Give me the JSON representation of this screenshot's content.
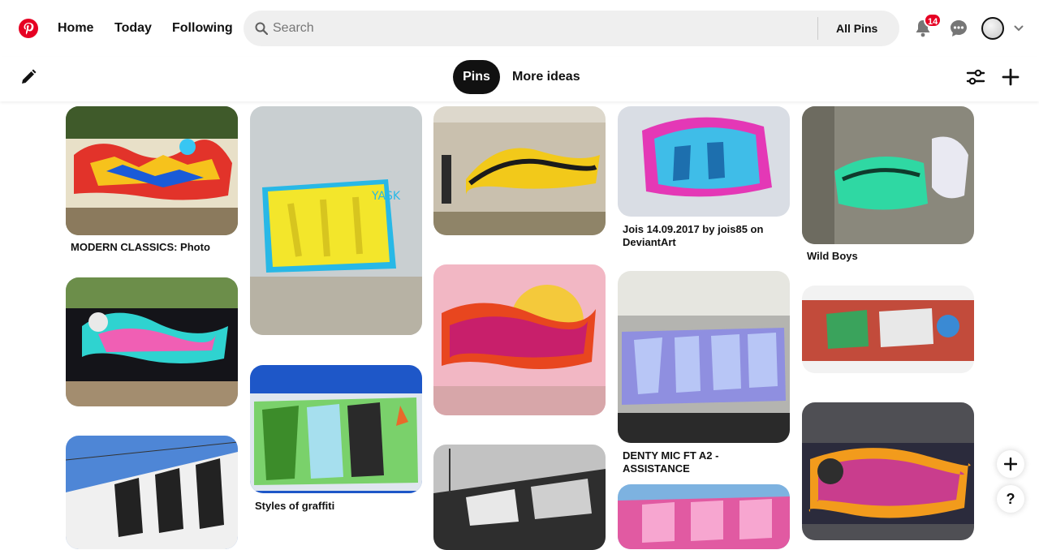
{
  "nav": {
    "home": "Home",
    "today": "Today",
    "following": "Following",
    "search_placeholder": "Search",
    "filter": "All Pins",
    "notifications_count": "14"
  },
  "subbar": {
    "pins_tab": "Pins",
    "more_ideas_tab": "More ideas"
  },
  "pins": [
    {
      "title": "MODERN CLASSICS: Photo"
    },
    {
      "title": ""
    },
    {
      "title": ""
    },
    {
      "title": "Jois 14.09.2017 by jois85 on DeviantArt"
    },
    {
      "title": "Wild Boys"
    },
    {
      "title": ""
    },
    {
      "title": "Styles of graffiti"
    },
    {
      "title": ""
    },
    {
      "title": "DENTY MIC FT A2 -ASSISTANCE"
    },
    {
      "title": ""
    },
    {
      "title": ""
    },
    {
      "title": ""
    },
    {
      "title": ""
    },
    {
      "title": ""
    }
  ],
  "help": {
    "label": "?"
  },
  "colors": {
    "brand": "#e60023",
    "active_tab": "#111111",
    "search_bg": "#efefef"
  }
}
